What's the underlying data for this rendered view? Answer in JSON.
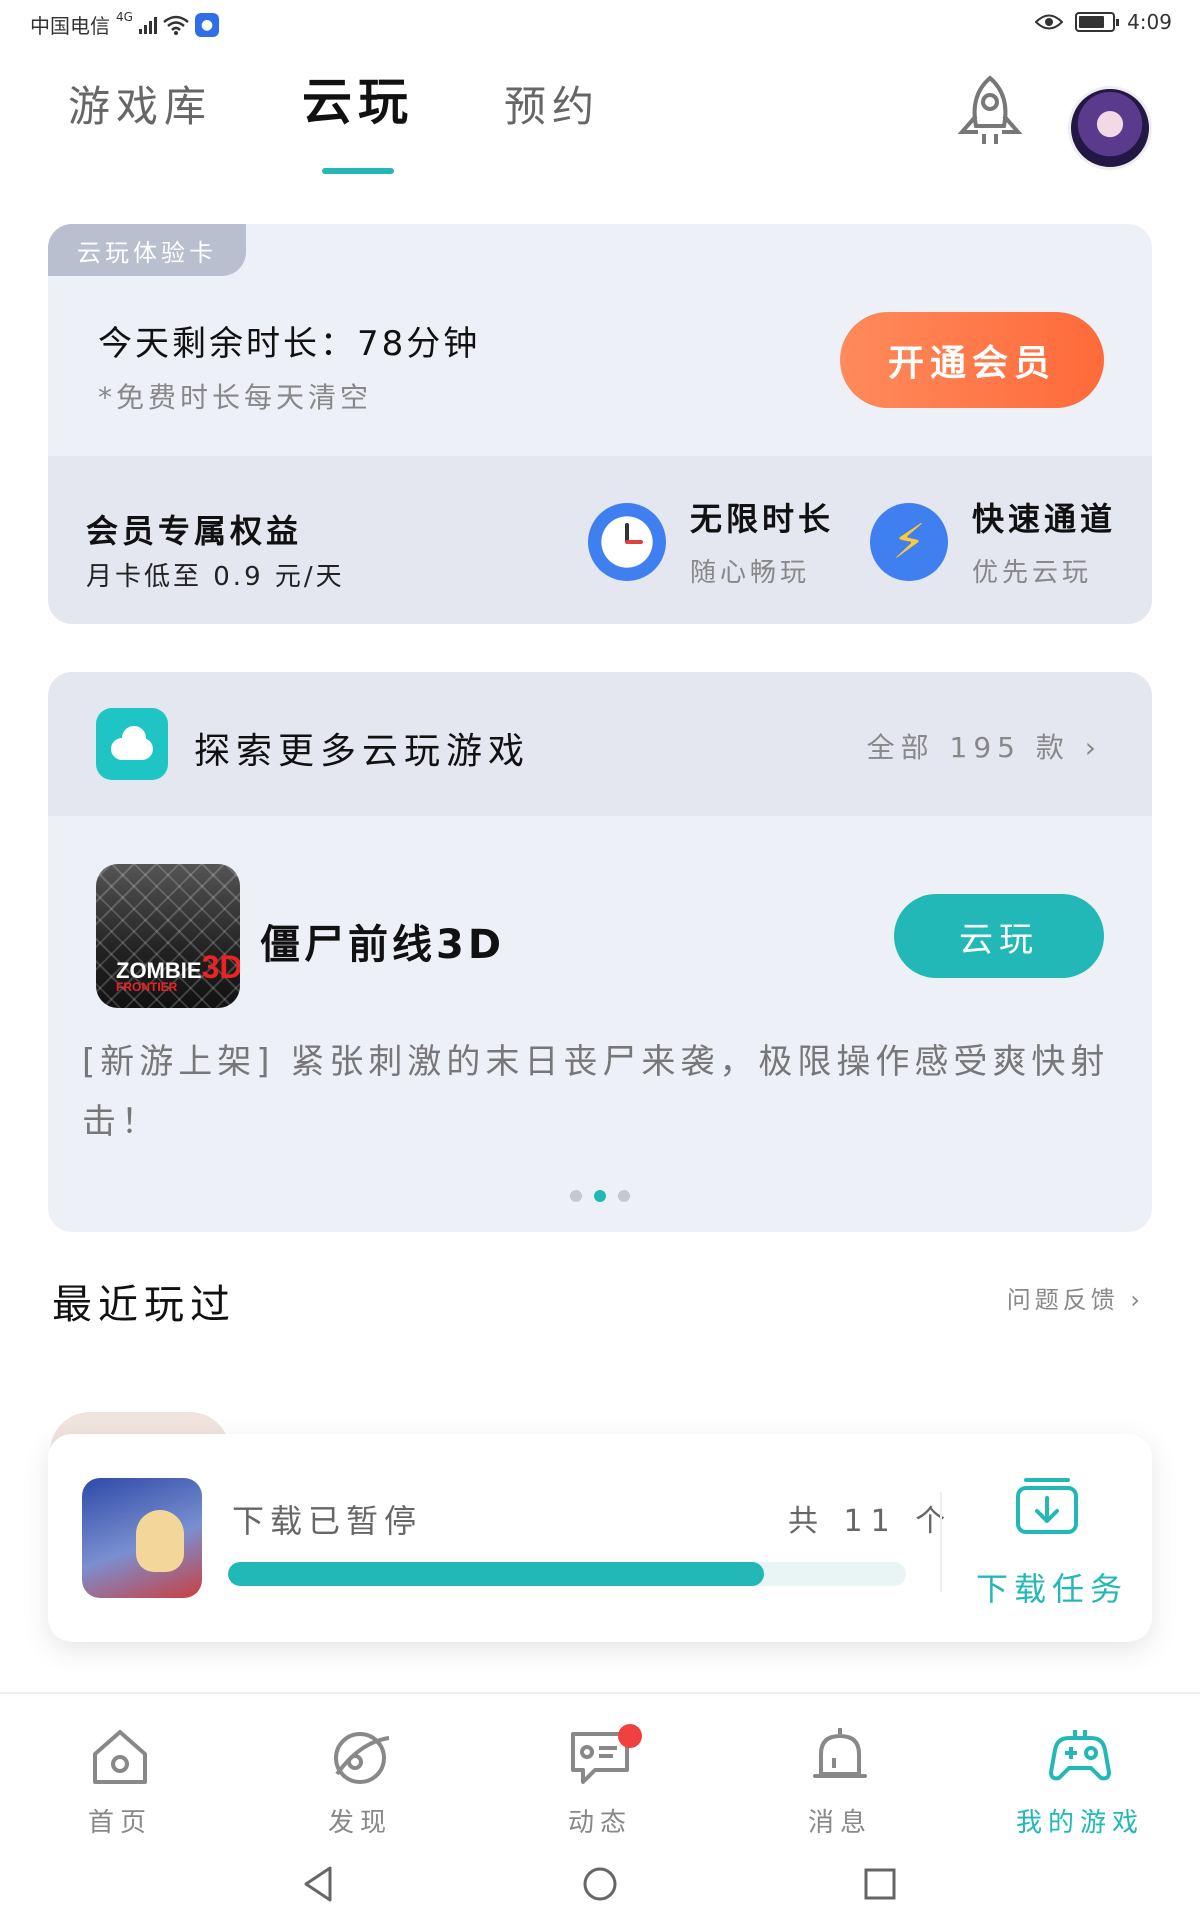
{
  "status": {
    "carrier": "中国电信",
    "network": "4G",
    "time": "4:09",
    "icons": [
      "signal-icon",
      "wifi-icon",
      "app-notification-icon",
      "eye-icon",
      "battery-icon"
    ]
  },
  "header": {
    "tabs": [
      {
        "label": "游戏库",
        "active": false
      },
      {
        "label": "云玩",
        "active": true
      },
      {
        "label": "预约",
        "active": false
      }
    ],
    "icons": [
      "rocket-icon",
      "avatar"
    ]
  },
  "trial": {
    "badge": "云玩体验卡",
    "remaining": "今天剩余时长：78分钟",
    "note": "*免费时长每天清空",
    "vip_button": "开通会员",
    "benefits": {
      "title": "会员专属权益",
      "subtitle": "月卡低至 0.9 元/天",
      "features": [
        {
          "title": "无限时长",
          "subtitle": "随心畅玩",
          "icon": "clock-icon"
        },
        {
          "title": "快速通道",
          "subtitle": "优先云玩",
          "icon": "lightning-icon"
        }
      ]
    }
  },
  "explore": {
    "title": "探索更多云玩游戏",
    "all_label": "全部 195 款 ›",
    "game": {
      "name": "僵尸前线3D",
      "icon_text_1": "ZOMBIE",
      "icon_text_2": "3D",
      "icon_text_3": "FRONTIER",
      "play_button": "云玩",
      "description": "[新游上架] 紧张刺激的末日丧尸来袭，极限操作感受爽快射击！"
    },
    "carousel": {
      "count": 3,
      "active": 1
    }
  },
  "recent": {
    "title": "最近玩过",
    "feedback": "问题反馈 ›"
  },
  "download": {
    "status": "下载已暂停",
    "count": "共 11 个",
    "progress": 0.79,
    "task_label": "下载任务"
  },
  "bottom_nav": [
    {
      "label": "首页",
      "icon": "home-icon",
      "active": false
    },
    {
      "label": "发现",
      "icon": "discover-icon",
      "active": false
    },
    {
      "label": "动态",
      "icon": "feed-icon",
      "active": false,
      "badge": true
    },
    {
      "label": "消息",
      "icon": "bell-icon",
      "active": false
    },
    {
      "label": "我的游戏",
      "icon": "gamepad-icon",
      "active": true
    }
  ],
  "colors": {
    "accent": "#23b8b8",
    "vip_orange": "#ff7a4a",
    "card_bg": "#eef0f8"
  }
}
